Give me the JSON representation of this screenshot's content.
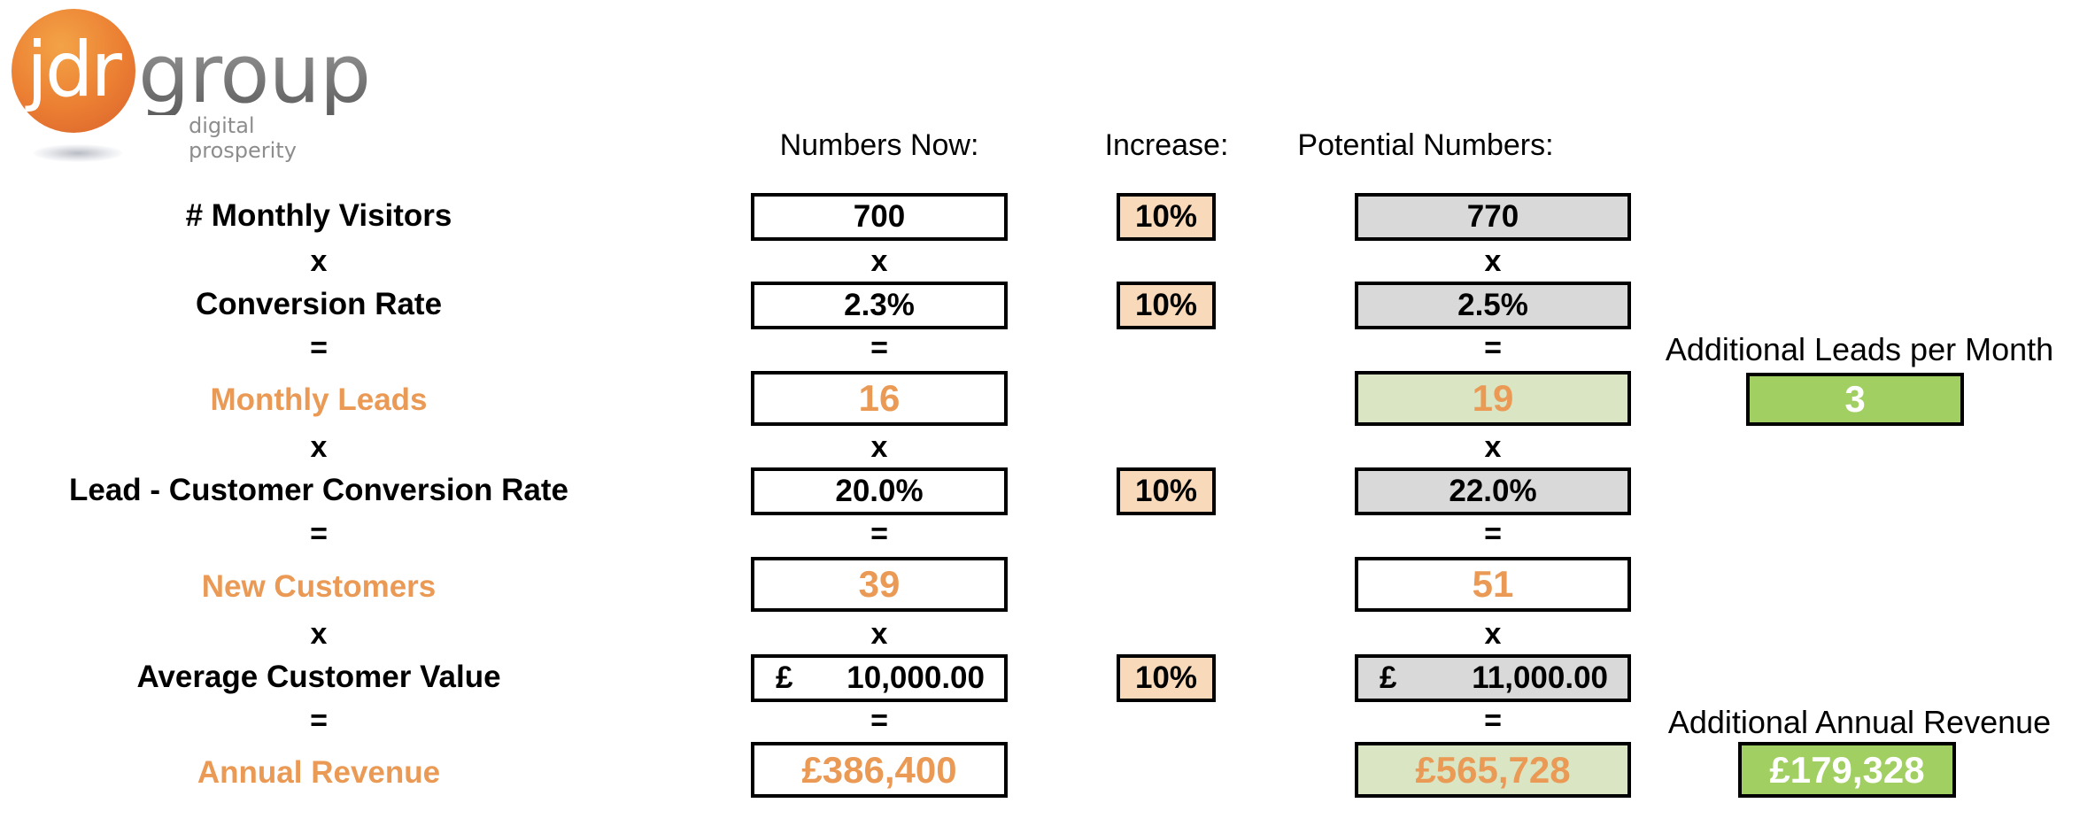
{
  "logo": {
    "mark": "jdr",
    "name": "group",
    "tagline": "digital prosperity",
    "brand_color": "#eb7e32"
  },
  "headers": {
    "now": "Numbers Now:",
    "increase": "Increase:",
    "potential": "Potential Numbers:"
  },
  "operators": {
    "multiply": "x",
    "equals": "="
  },
  "rows": {
    "visitors": {
      "label": "# Monthly Visitors",
      "now": "700",
      "increase": "10%",
      "potential": "770"
    },
    "conversion": {
      "label": "Conversion Rate",
      "now": "2.3%",
      "increase": "10%",
      "potential": "2.5%"
    },
    "leads": {
      "label": "Monthly Leads",
      "now": "16",
      "potential": "19"
    },
    "lead_conversion": {
      "label": "Lead - Customer Conversion Rate",
      "now": "20.0%",
      "increase": "10%",
      "potential": "22.0%"
    },
    "customers": {
      "label": "New Customers",
      "now": "39",
      "potential": "51"
    },
    "avg_value": {
      "label": "Average Customer Value",
      "currency": "£",
      "now": "10,000.00",
      "increase": "10%",
      "potential": "11,000.00"
    },
    "revenue": {
      "label": "Annual Revenue",
      "now": "£386,400",
      "potential": "£565,728"
    }
  },
  "additional": {
    "leads_label": "Additional Leads per Month",
    "leads_value": "3",
    "revenue_label": "Additional Annual Revenue",
    "revenue_value": "£179,328"
  },
  "colors": {
    "accent_orange": "#ea9a55",
    "increase_fill": "#f8d9ba",
    "potential_fill": "#d9d9d9",
    "result_fill": "#d9e5c3",
    "additional_fill": "#a1cf62"
  }
}
